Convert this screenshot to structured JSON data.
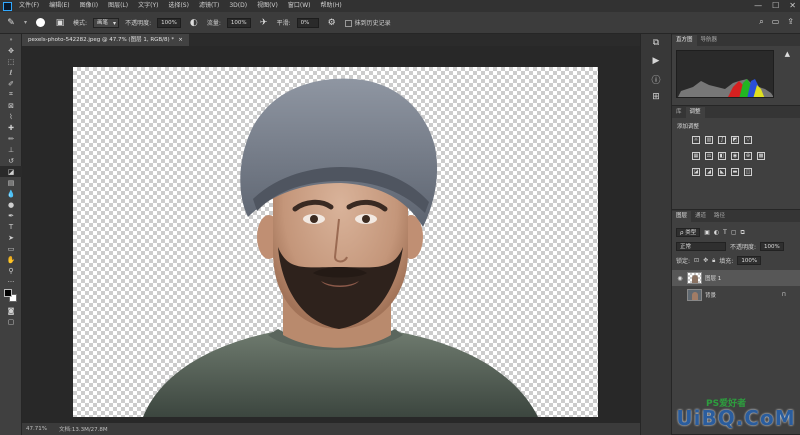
{
  "menubar": {
    "items": [
      "文件(F)",
      "编辑(E)",
      "图像(I)",
      "图层(L)",
      "文字(Y)",
      "选择(S)",
      "滤镜(T)",
      "3D(D)",
      "视图(V)",
      "窗口(W)",
      "帮助(H)"
    ],
    "window_controls": [
      "—",
      "☐",
      "✕"
    ]
  },
  "options": {
    "mode_label": "模式:",
    "mode_value": "画笔",
    "opacity_label": "不透明度:",
    "opacity_value": "100%",
    "flow_label": "流量:",
    "flow_value": "100%",
    "smoothing_label": "平滑:",
    "smoothing_value": "0%",
    "history_label": "抹到历史记录"
  },
  "document": {
    "tab_title": "pexels-photo-542282.jpeg @ 47.7% (图层 1, RGB/8) *",
    "tab_close": "×"
  },
  "status": {
    "zoom": "47.71%",
    "doc_size": "文档:13.3M/27.8M"
  },
  "panels": {
    "histogram_tabs": [
      "直方图",
      "导航器"
    ],
    "adjust_tabs": [
      "库",
      "调整"
    ],
    "adjust_title": "添加调整",
    "layers_tabs": [
      "图层",
      "通道",
      "路径"
    ],
    "kind_label": "ρ 类型",
    "blend_mode": "正常",
    "opacity_label": "不透明度:",
    "opacity_value": "100%",
    "lock_label": "锁定:",
    "fill_label": "填充:",
    "fill_value": "100%",
    "layers": [
      {
        "name": "图层 1",
        "visible": true,
        "selected": true
      },
      {
        "name": "背景",
        "visible": false,
        "selected": false,
        "locked": true
      }
    ]
  },
  "watermark": {
    "text": "UiBQ.CoM",
    "sub": "PS爱好者"
  }
}
